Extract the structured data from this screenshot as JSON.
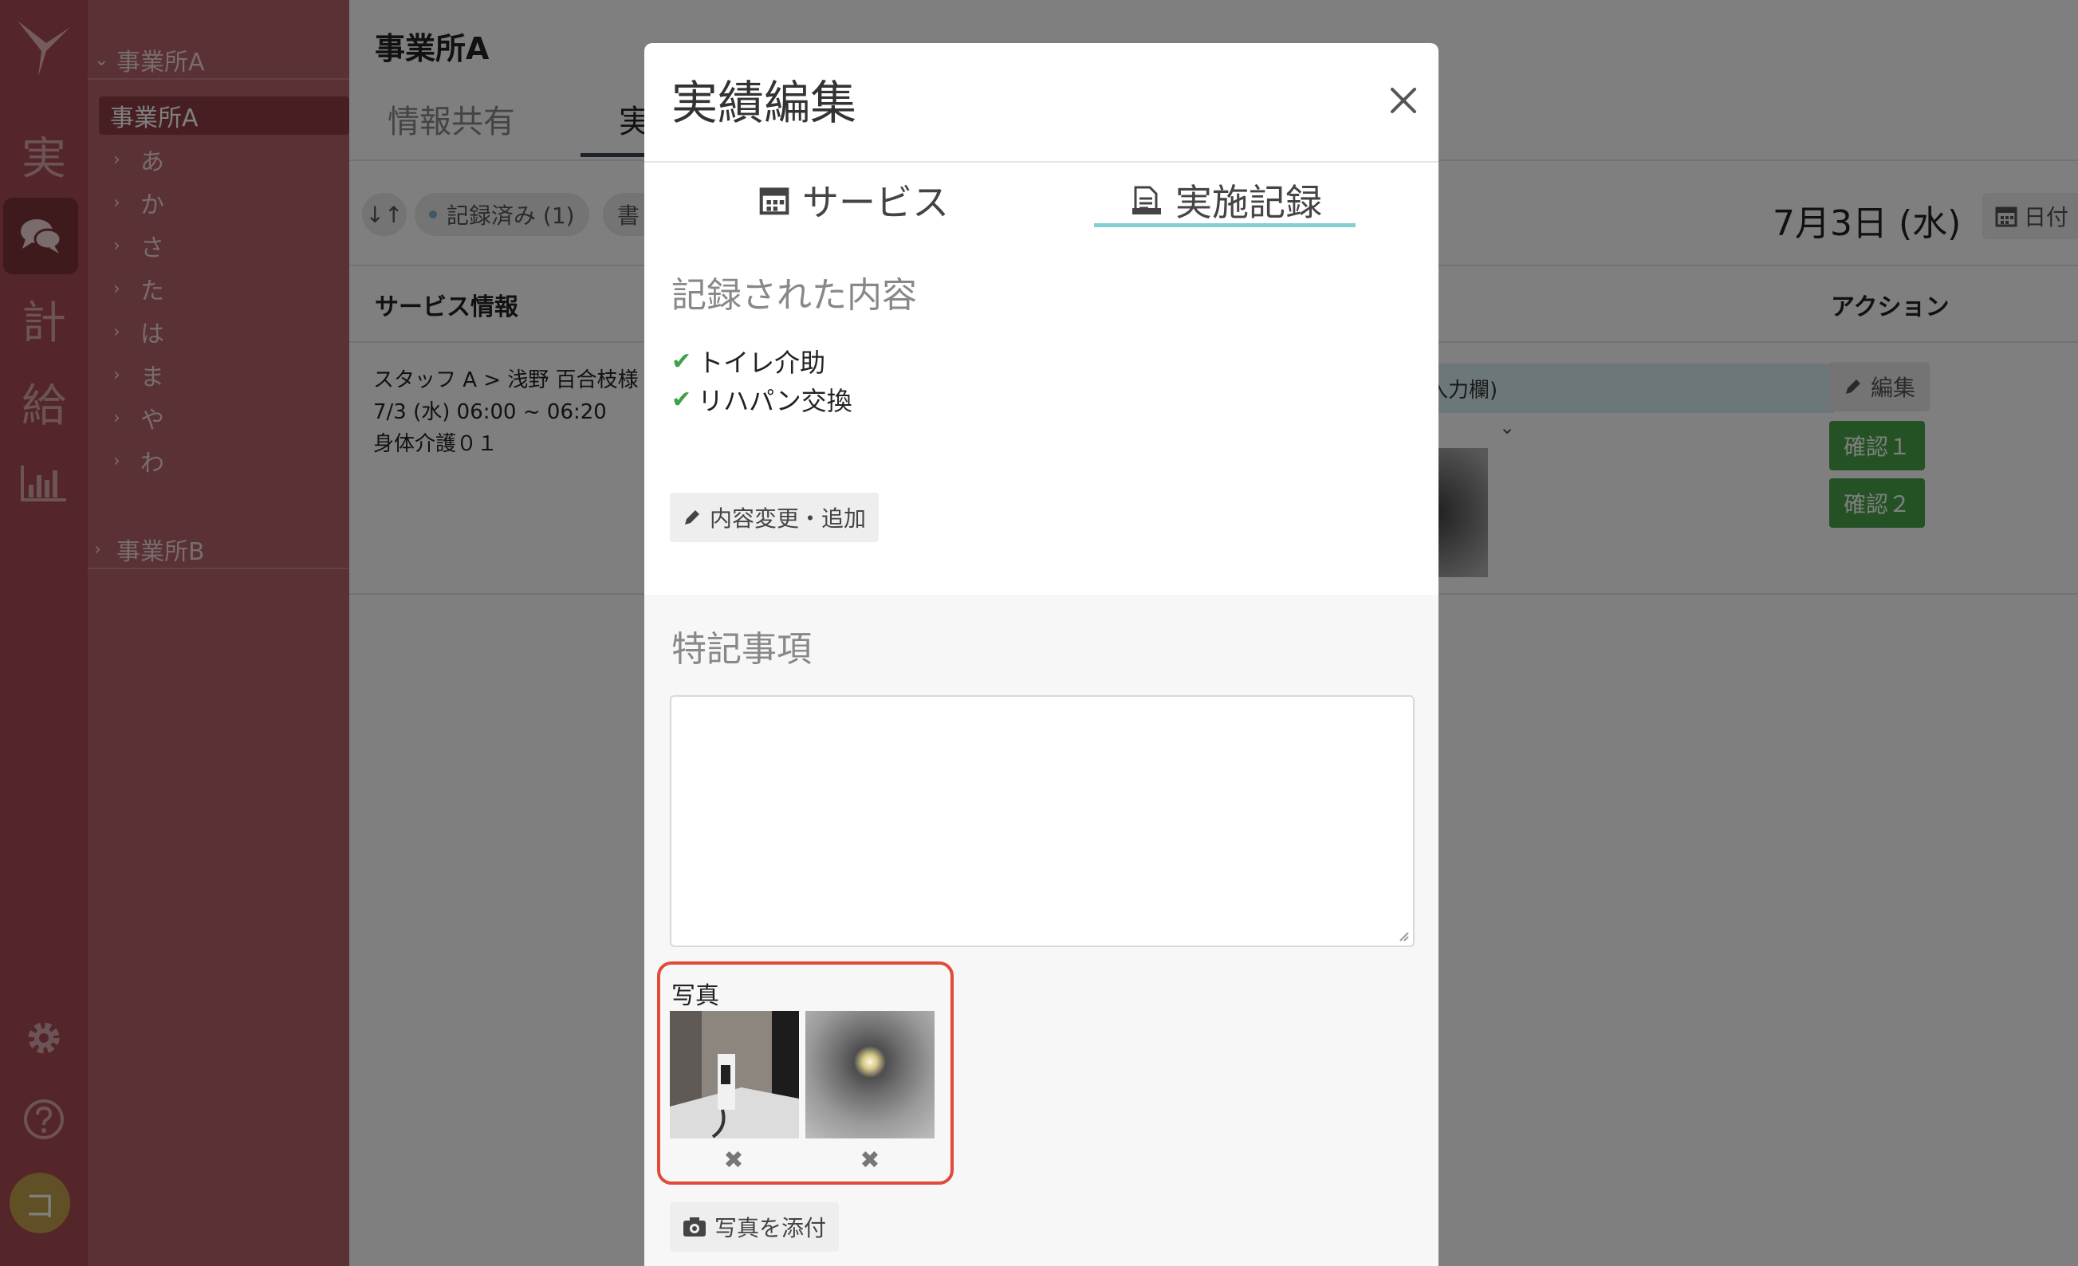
{
  "rail": {
    "items": [
      {
        "label": "実",
        "name": "jisseki"
      },
      {
        "label": "",
        "name": "chat-icon"
      },
      {
        "label": "計",
        "name": "keikaku"
      },
      {
        "label": "給",
        "name": "kyuyo"
      },
      {
        "label": "",
        "name": "chart-icon"
      }
    ],
    "avatar": "コ"
  },
  "tree": {
    "office_a": "事業所A",
    "current": "事業所A",
    "kana": [
      "あ",
      "か",
      "さ",
      "た",
      "は",
      "ま",
      "や",
      "わ"
    ],
    "office_b": "事業所B"
  },
  "main": {
    "title": "事業所A",
    "tabs": [
      "情報共有",
      "実"
    ],
    "filters": {
      "sort_label": "↓↑",
      "recorded": "記録済み (1)",
      "other": "書"
    },
    "date": "7月3日 (水)",
    "date_button": "日付",
    "headers": {
      "service_info": "サービス情報",
      "action": "アクション"
    },
    "row": {
      "staff": "スタッフ A > 浅野 百合枝様",
      "time": "7/3 (水) 06:00 ~ 06:20",
      "service": "身体介護０１",
      "record_text": "入力欄)",
      "edit": "編集",
      "confirm1": "確認１",
      "confirm2": "確認２"
    }
  },
  "modal": {
    "title": "実績編集",
    "tabs": {
      "service": "サービス",
      "record": "実施記録"
    },
    "recorded_title": "記録された内容",
    "checks": [
      "トイレ介助",
      "リハパン交換"
    ],
    "change_button": "内容変更・追加",
    "notes_title": "特記事項",
    "notes_value": "",
    "photo_label": "写真",
    "attach_button": "写真を添付"
  },
  "colors": {
    "rail": "#a84d52",
    "tree": "#b46368",
    "accent_teal": "#84cfd1",
    "confirm_green": "#4aa44a",
    "highlight_red": "#e04b3a"
  }
}
